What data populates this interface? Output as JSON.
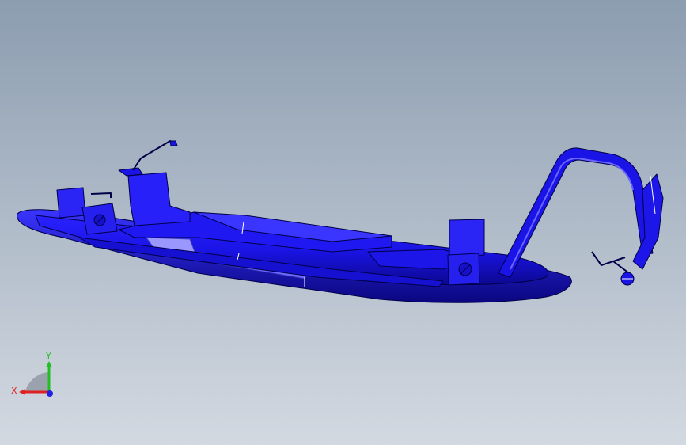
{
  "viewport": {
    "background_top": "#8c9db0",
    "background_bottom": "#d3d9e1"
  },
  "model": {
    "color": "#1a14e6",
    "dark_color": "#0c0890",
    "highlight_color": "#5a55ff",
    "edge_color": "#00004a"
  },
  "triad": {
    "x_label": "X",
    "y_label": "Y",
    "x_color": "#e02020",
    "y_color": "#20c020",
    "z_color": "#2020e0"
  }
}
